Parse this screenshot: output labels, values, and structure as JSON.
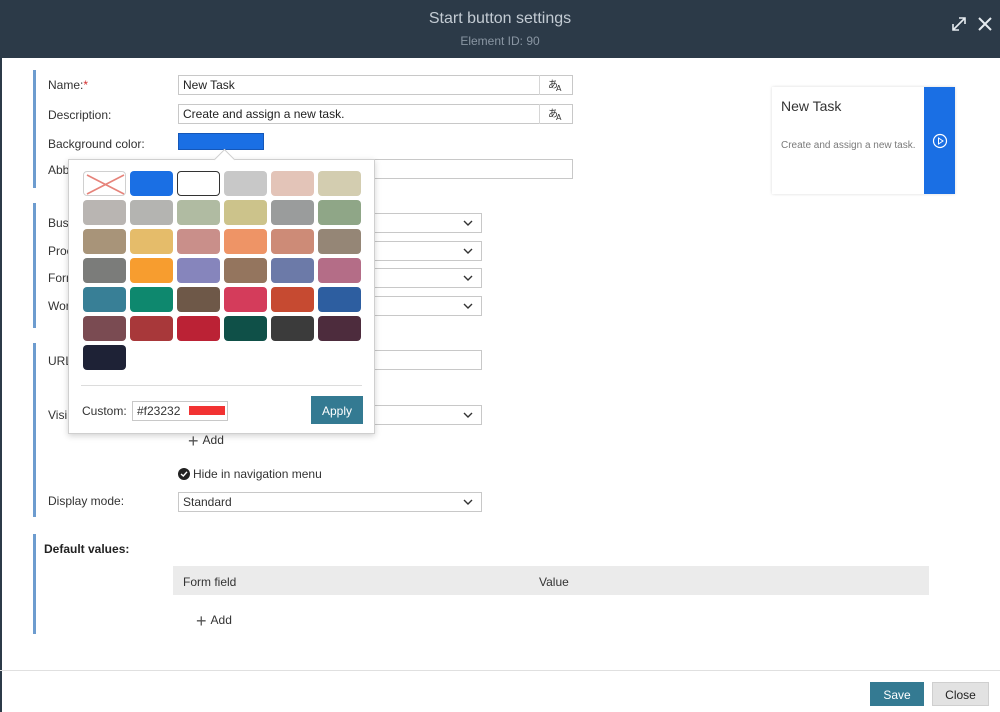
{
  "header": {
    "title": "Start button settings",
    "subtitle": "Element ID: 90",
    "expand_icon": "expand-icon",
    "close_icon": "close-icon"
  },
  "form": {
    "name_label": "Name:",
    "name_required": "*",
    "name_value": "New Task",
    "description_label": "Description:",
    "description_value": "Create and assign a new task.",
    "bgcolor_label": "Background color:",
    "bgcolor_value": "#1a6fe4",
    "abbr_label_partial": "Abb",
    "bus_label_partial": "Bus",
    "proc_label_partial": "Proc",
    "form_label_partial": "Form",
    "work_label_partial": "Wor",
    "url_label_partial": "URL",
    "visi_label_partial": "Visi",
    "add_label": "Add",
    "hide_nav_label": "Hide in navigation menu",
    "display_mode_label": "Display mode:",
    "display_mode_value": "Standard"
  },
  "preview": {
    "title": "New Task",
    "description": "Create and assign a new task.",
    "accent": "#1a6fe4",
    "icon": "play-circle-icon"
  },
  "picker": {
    "swatches": [
      [
        "none",
        "#1a6fe4",
        "#ffffff",
        "#c8c8c8",
        "#e3c4b8",
        "#d3cdb0"
      ],
      [
        "#b9b5b2",
        "#b4b4b1",
        "#b0bba2",
        "#ccc38b",
        "#9a9c9c",
        "#8fa687"
      ],
      [
        "#a89479",
        "#e5bc6a",
        "#c98f8a",
        "#ee9466",
        "#cd8b77",
        "#958676"
      ],
      [
        "#7b7c7a",
        "#f79d2f",
        "#8685bc",
        "#94755e",
        "#6c7aa8",
        "#b46d87"
      ],
      [
        "#387f96",
        "#0e886e",
        "#6e5848",
        "#d43c5b",
        "#c64a31",
        "#2d5ea0"
      ],
      [
        "#7a4b52",
        "#a8383a",
        "#bb2235",
        "#0f5048",
        "#3b3b3b",
        "#4d2c3d"
      ],
      [
        "#1e2236"
      ]
    ],
    "selected": "#ffffff",
    "custom_label": "Custom:",
    "custom_value": "#f23232",
    "custom_color": "#f23232",
    "apply_label": "Apply"
  },
  "defaults": {
    "title": "Default values:",
    "columns": [
      "Form field",
      "Value"
    ],
    "add_label": "Add"
  },
  "footer": {
    "save_label": "Save",
    "close_label": "Close"
  }
}
